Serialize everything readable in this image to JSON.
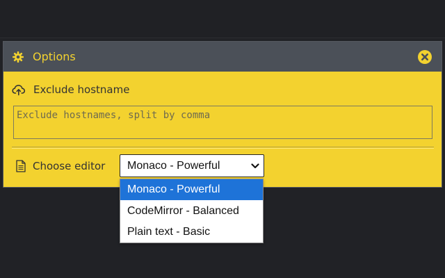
{
  "panel": {
    "title": "Options",
    "close_icon": "close-icon",
    "settings_icon": "gear-icon"
  },
  "exclude": {
    "label": "Exclude hostname",
    "icon": "cloud-upload-icon",
    "placeholder": "Exclude hostnames, split by comma",
    "value": ""
  },
  "editor": {
    "label": "Choose editor",
    "icon": "document-icon",
    "selected": "Monaco - Powerful",
    "options": [
      "Monaco - Powerful",
      "CodeMirror - Balanced",
      "Plain text - Basic"
    ]
  },
  "colors": {
    "accent": "#f3d22f",
    "header": "#4b5058",
    "background": "#212226",
    "selection": "#1e73d8"
  }
}
